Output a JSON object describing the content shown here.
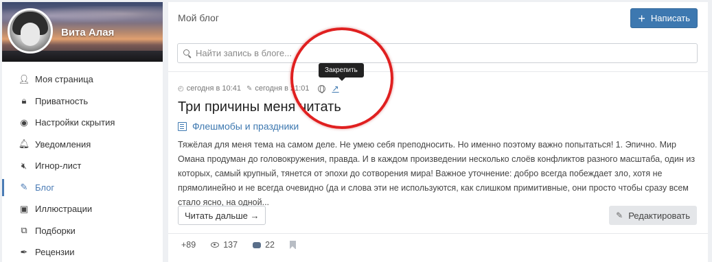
{
  "sidebar": {
    "profile_name": "Вита Алая",
    "items": [
      {
        "label": "Моя страница",
        "icon": "user-icon"
      },
      {
        "label": "Приватность",
        "icon": "lock-icon"
      },
      {
        "label": "Настройки скрытия",
        "icon": "eye-slash-icon"
      },
      {
        "label": "Уведомления",
        "icon": "bell-icon"
      },
      {
        "label": "Игнор-лист",
        "icon": "volume-off-icon"
      },
      {
        "label": "Блог",
        "icon": "blog-icon",
        "active": true
      },
      {
        "label": "Иллюстрации",
        "icon": "image-icon"
      },
      {
        "label": "Подборки",
        "icon": "collections-icon"
      },
      {
        "label": "Рецензии",
        "icon": "quill-icon"
      }
    ]
  },
  "main": {
    "title": "Мой блог",
    "write_button": "Написать",
    "search_placeholder": "Найти запись в блоге...",
    "post": {
      "created": "сегодня в 10:41",
      "edited": "сегодня в 21:01",
      "tooltip": "Закрепить",
      "title": "Три причины меня читать",
      "category": "Флешмобы и праздники",
      "excerpt": "Тяжёлая для меня тема на самом деле. Не умею себя преподносить. Но именно поэтому важно попытаться! 1. Эпично. Мир Омана продуман до головокружения, правда. И в каждом произведении несколько слоёв конфликтов разного масштаба, один из которых, самый крупный, тянется от эпохи до сотворения мира! Важное уточнение: добро всегда побеждает зло, хотя не прямолинейно и не всегда очевидно (да и слова эти не используются, как слишком примитивные, они просто чтобы сразу всем стало ясно, на одной...",
      "read_more": "Читать дальше →",
      "edit": "Редактировать",
      "stats": {
        "rating": "+89",
        "views": "137",
        "comments": "22"
      }
    }
  },
  "colors": {
    "accent": "#3d78b0",
    "highlight": "#e02020"
  }
}
